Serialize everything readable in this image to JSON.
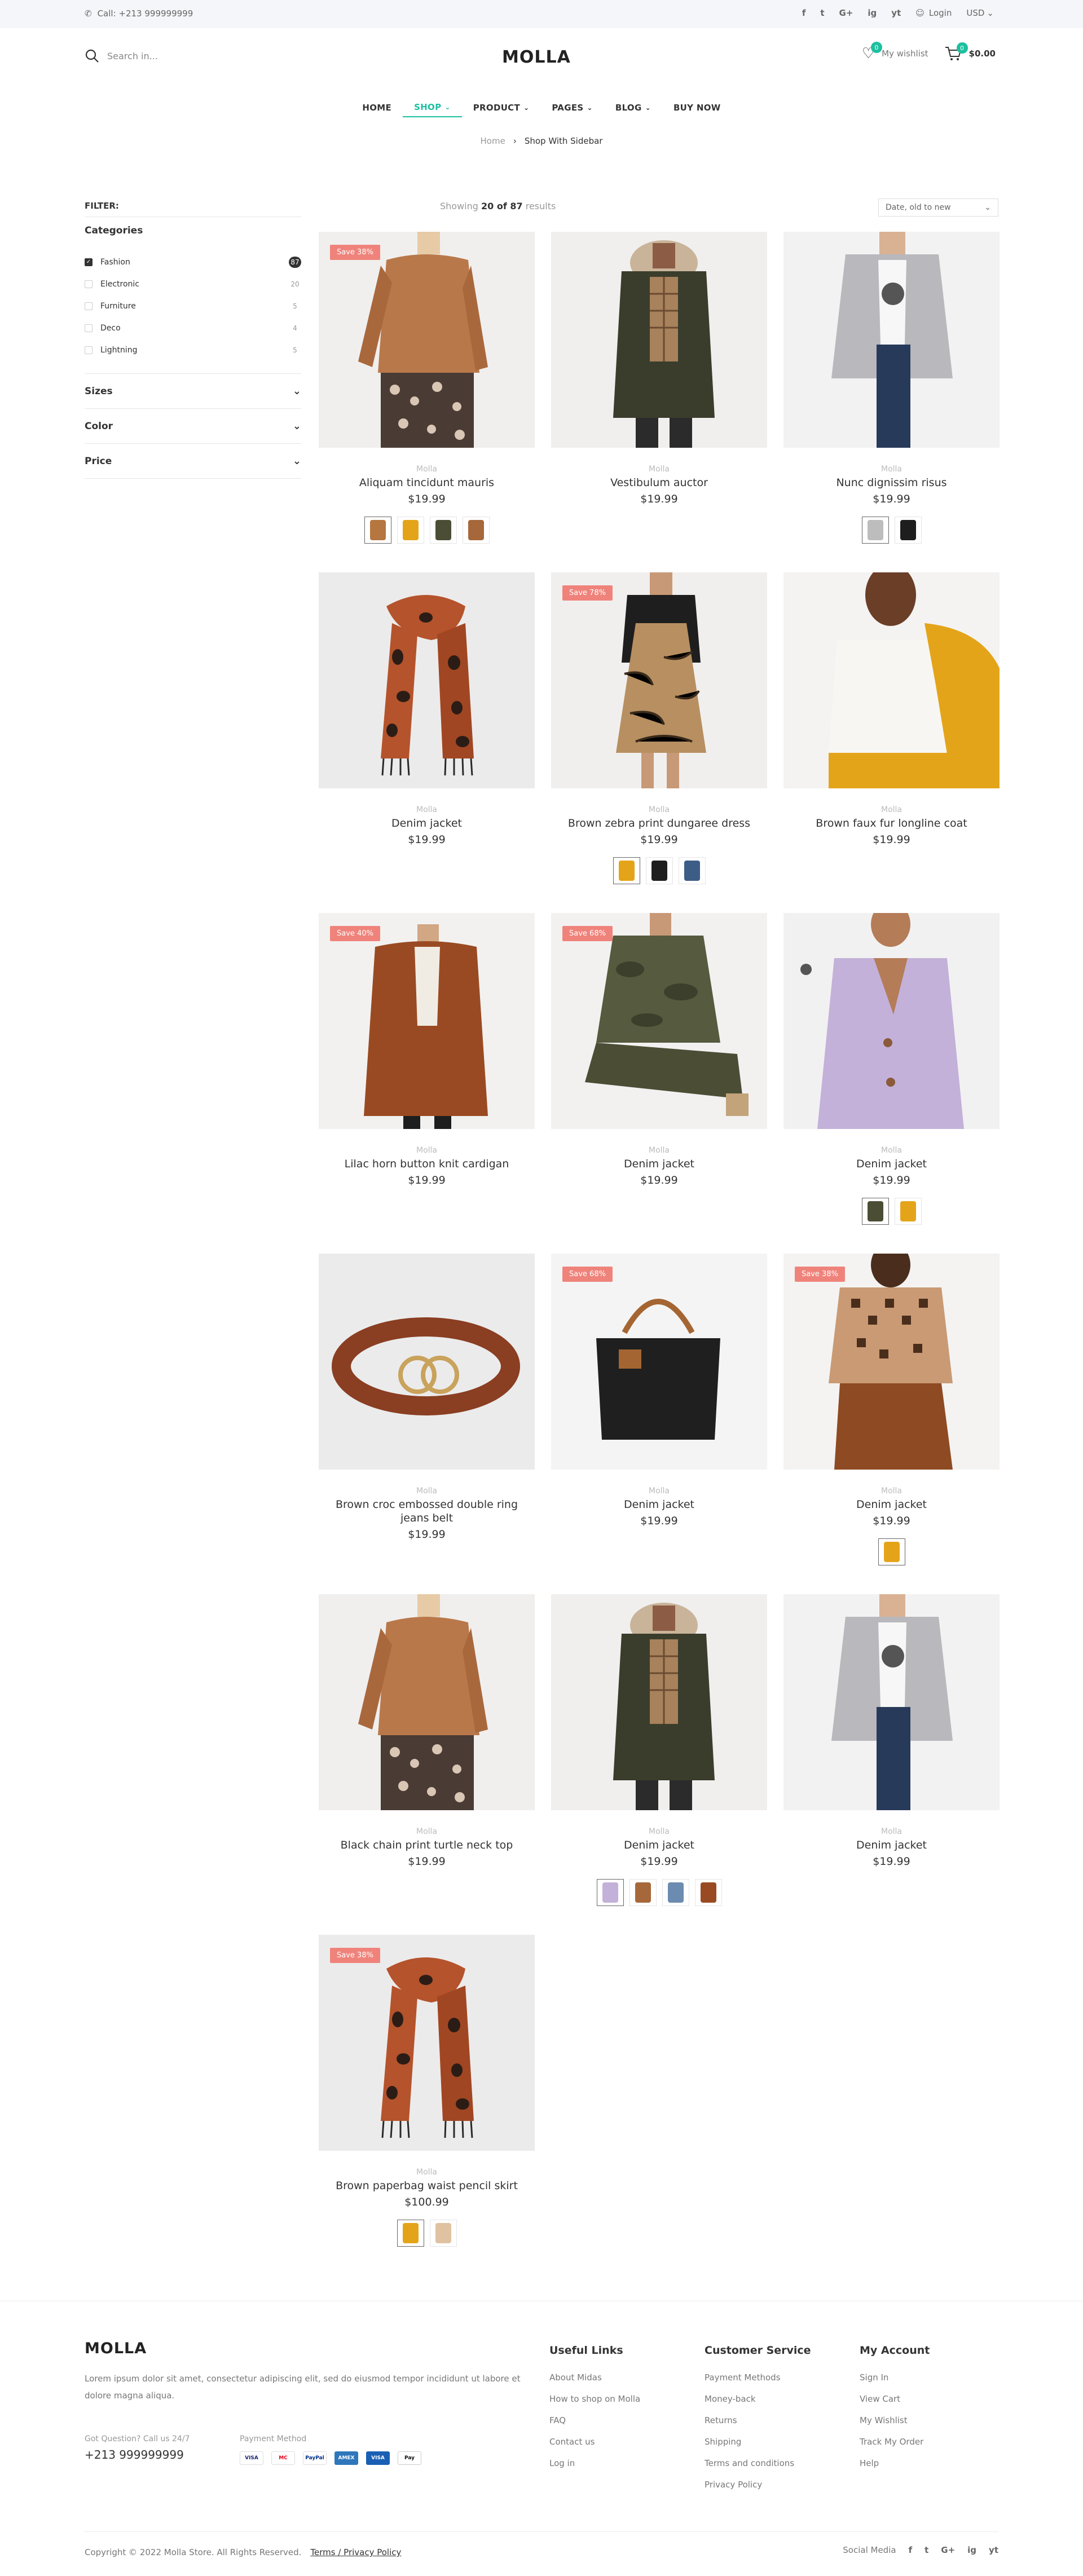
{
  "topbar": {
    "call": "Call: +213 999999999",
    "login": "Login",
    "currency": "USD",
    "socials": [
      "f",
      "t",
      "G+",
      "ig",
      "yt"
    ]
  },
  "header": {
    "logo": "MOLLA",
    "search_placeholder": "Search in...",
    "wishlist": "My wishlist",
    "wishlist_count": "0",
    "cart_total": "$0.00",
    "cart_count": "0"
  },
  "nav": [
    {
      "label": "HOME"
    },
    {
      "label": "SHOP",
      "active": true,
      "caret": true
    },
    {
      "label": "PRODUCT",
      "caret": true
    },
    {
      "label": "PAGES",
      "caret": true
    },
    {
      "label": "BLOG",
      "caret": true
    },
    {
      "label": "BUY NOW"
    }
  ],
  "breadcrumb": {
    "home": "Home",
    "current": "Shop With Sidebar"
  },
  "toolbar": {
    "showing": "Showing",
    "current": "20 of 87",
    "suffix": "results",
    "sort": "Date, old to new"
  },
  "sidebar": {
    "filter": "FILTER:",
    "categories_title": "Categories",
    "categories": [
      {
        "label": "Fashion",
        "count": "87",
        "checked": true
      },
      {
        "label": "Electronic",
        "count": "20",
        "checked": false
      },
      {
        "label": "Furniture",
        "count": "5",
        "checked": false
      },
      {
        "label": "Deco",
        "count": "4",
        "checked": false
      },
      {
        "label": "Lightning",
        "count": "5",
        "checked": false
      }
    ],
    "accordions": [
      "Sizes",
      "Color",
      "Price"
    ]
  },
  "products": [
    {
      "brand": "Molla",
      "name": "Aliquam tincidunt mauris",
      "price": "$19.99",
      "save": "Save 38%",
      "img": "sweater",
      "swatches": [
        "coat",
        "yellow",
        "olive",
        "tan"
      ]
    },
    {
      "brand": "Molla",
      "name": "Vestibulum auctor",
      "price": "$19.99",
      "save": "",
      "img": "parka",
      "swatches": []
    },
    {
      "brand": "Molla",
      "name": "Nunc dignissim risus",
      "price": "$19.99",
      "save": "",
      "img": "cardigan",
      "swatches": [
        "grey",
        "black"
      ]
    },
    {
      "brand": "Molla",
      "name": "Denim jacket",
      "price": "$19.99",
      "save": "",
      "img": "scarf",
      "swatches": []
    },
    {
      "brand": "Molla",
      "name": "Brown zebra print dungaree dress",
      "price": "$19.99",
      "save": "Save 78%",
      "img": "dress",
      "swatches": [
        "yellow",
        "black",
        "blue"
      ]
    },
    {
      "brand": "Molla",
      "name": "Brown faux fur longline coat",
      "price": "$19.99",
      "save": "",
      "img": "tee",
      "swatches": []
    },
    {
      "brand": "Molla",
      "name": "Lilac horn button knit cardigan",
      "price": "$19.99",
      "save": "Save 40%",
      "img": "furcoat",
      "swatches": []
    },
    {
      "brand": "Molla",
      "name": "Denim jacket",
      "price": "$19.99",
      "save": "Save 68%",
      "img": "camo",
      "swatches": []
    },
    {
      "brand": "Molla",
      "name": "Denim jacket",
      "price": "$19.99",
      "save": "",
      "img": "lilac",
      "swatches": [
        "olive",
        "yellow"
      ]
    },
    {
      "brand": "Molla",
      "name": "Brown croc embossed double ring jeans belt",
      "price": "$19.99",
      "save": "",
      "img": "belt",
      "swatches": []
    },
    {
      "brand": "Molla",
      "name": "Denim jacket",
      "price": "$19.99",
      "save": "Save 68%",
      "img": "bag",
      "swatches": []
    },
    {
      "brand": "Molla",
      "name": "Denim jacket",
      "price": "$19.99",
      "save": "Save 38%",
      "img": "turtle",
      "swatches": [
        "yellow"
      ]
    },
    {
      "brand": "Molla",
      "name": "Black chain print turtle neck top",
      "price": "$19.99",
      "save": "",
      "img": "sweater",
      "swatches": []
    },
    {
      "brand": "Molla",
      "name": "Denim jacket",
      "price": "$19.99",
      "save": "",
      "img": "parka",
      "swatches": [
        "lilac",
        "tan",
        "denim",
        "brown"
      ]
    },
    {
      "brand": "Molla",
      "name": "Denim jacket",
      "price": "$19.99",
      "save": "",
      "img": "cardigan",
      "swatches": []
    },
    {
      "brand": "Molla",
      "name": "Brown paperbag waist pencil skirt",
      "price": "$100.99",
      "save": "Save 38%",
      "img": "scarf",
      "swatches": [
        "yellow",
        "beige"
      ]
    }
  ],
  "footer": {
    "logo": "MOLLA",
    "about": "Lorem ipsum dolor sit amet, consectetur adipiscing elit, sed do eiusmod tempor incididunt ut labore et dolore magna aliqua.",
    "question": "Got Question? Call us 24/7",
    "phone": "+213 999999999",
    "payment_title": "Payment Method",
    "cards": [
      "VISA",
      "MC",
      "PayPal",
      "AMEX",
      "VISA",
      "Pay"
    ],
    "col1": {
      "title": "Useful Links",
      "links": [
        "About Midas",
        "How to shop on Molla",
        "FAQ",
        "Contact us",
        "Log in"
      ]
    },
    "col2": {
      "title": "Customer Service",
      "links": [
        "Payment Methods",
        "Money-back",
        "Returns",
        "Shipping",
        "Terms and conditions",
        "Privacy Policy"
      ]
    },
    "col3": {
      "title": "My Account",
      "links": [
        "Sign In",
        "View Cart",
        "My Wishlist",
        "Track My Order",
        "Help"
      ]
    },
    "copyright": "Copyright © 2022 Molla Store. All Rights Reserved.",
    "terms": "Terms / Privacy Policy",
    "social_label": "Social Media"
  },
  "colors": {
    "accent": "#1cc0a0",
    "save": "#ef837b"
  }
}
